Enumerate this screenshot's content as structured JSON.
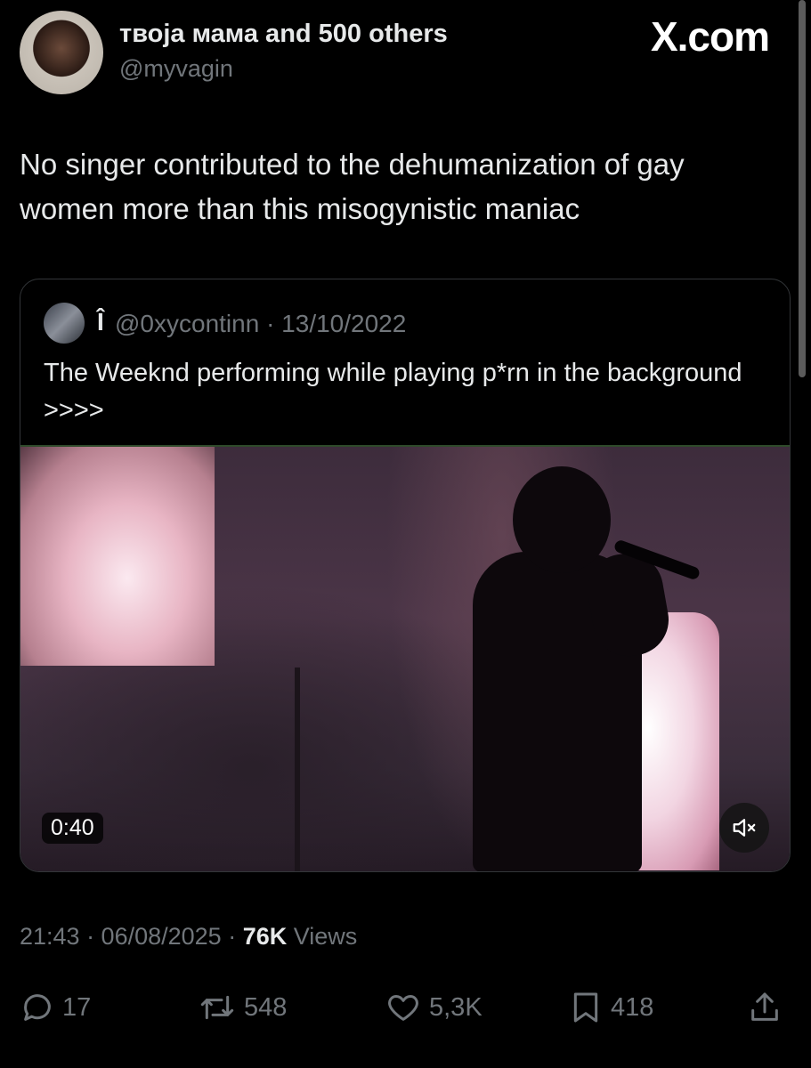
{
  "brand": {
    "logo_text": "X.com"
  },
  "post": {
    "display_name": "твоја мама and 500 others",
    "handle": "@myvagin",
    "text": "No singer contributed to the dehumanization of gay women more than this misogynistic maniac"
  },
  "quote": {
    "name": "Î",
    "handle_date": "@0xycontinn · 13/10/2022",
    "text": "The Weeknd performing while playing p*rn in the background >>>>",
    "video": {
      "duration": "0:40"
    }
  },
  "meta": {
    "time_date": "21:43 · 06/08/2025 · ",
    "views_count": "76K",
    "views_label": " Views"
  },
  "actions": {
    "reply_count": "17",
    "repost_count": "548",
    "like_count": "5,3K",
    "bookmark_count": "418"
  },
  "colors": {
    "background": "#000000",
    "text_primary": "#e7e9ea",
    "text_secondary": "#71767b",
    "border": "#333639"
  }
}
